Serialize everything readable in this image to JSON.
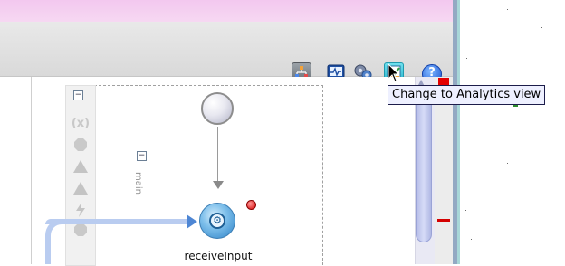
{
  "toolbar": {
    "buttons": [
      {
        "name": "design-view",
        "icon": "design-view-icon"
      },
      {
        "name": "monitor-view",
        "icon": "monitor-icon"
      },
      {
        "name": "settings",
        "icon": "settings-icon"
      },
      {
        "name": "analytics-view",
        "icon": "analytics-icon",
        "active": true
      },
      {
        "name": "help",
        "icon": "help-icon",
        "label": "?"
      }
    ]
  },
  "tooltip": {
    "text": "Change to Analytics view"
  },
  "palette": {
    "collapse_symbol": "−",
    "variables_label": "(x)"
  },
  "process": {
    "lane_collapse_symbol": "−",
    "lane_label": "main",
    "receive_label": "receiveInput"
  },
  "colors": {
    "header_pink": "#f3c8ef",
    "toolbar_gray": "#dedede",
    "accent_blue": "#2d82c7",
    "error_red": "#e30000",
    "analytics_cyan": "#2bb7cd"
  }
}
